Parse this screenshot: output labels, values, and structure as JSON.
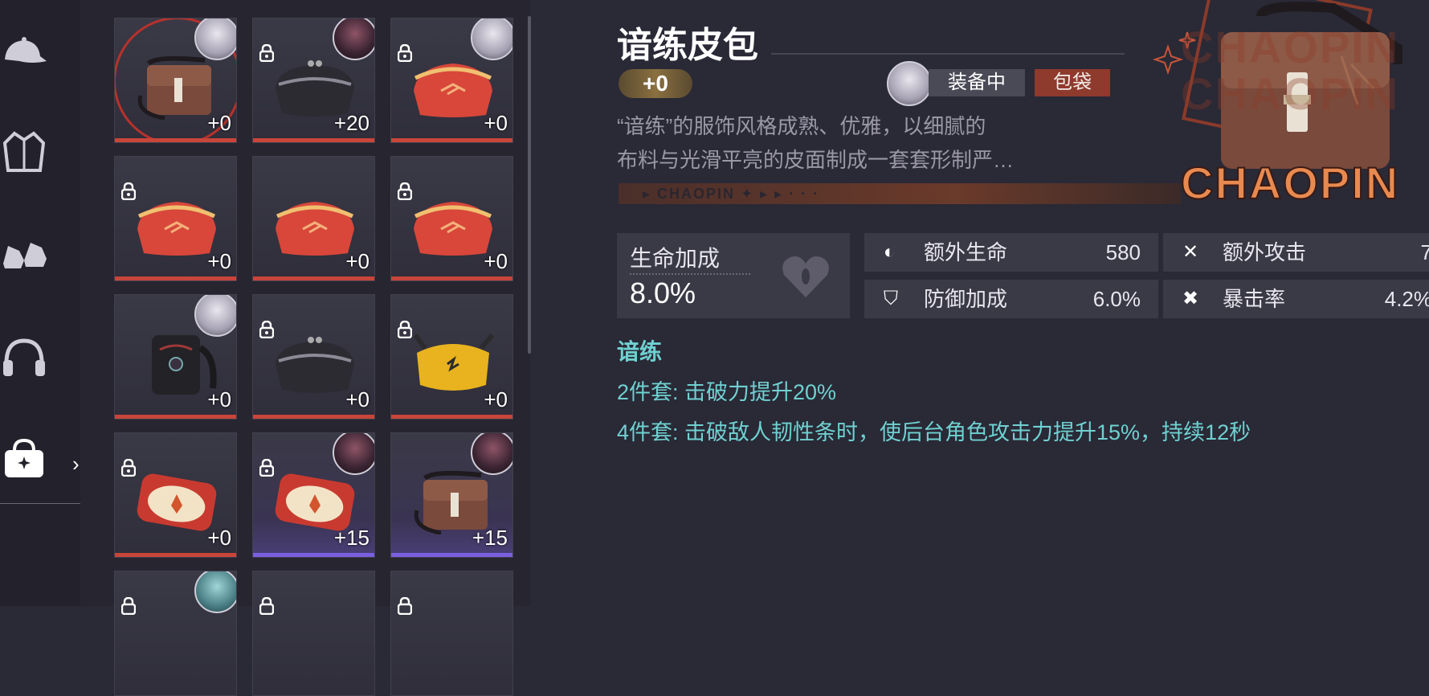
{
  "item": {
    "name": "谙练皮包",
    "level": "+0",
    "equipped_label": "装备中",
    "slot_label": "包袋",
    "description_line1": "“谙练”的服饰风格成熟、优雅，以细腻的",
    "description_line2": "布料与光滑平亮的皮面制成一套套形制严…",
    "brand_strip": "▸ CHAOPIN ✦ ▸ ▸ · · ·",
    "brand_big": "CHAOPIN",
    "brand_ghost": "CHAOPIN"
  },
  "main_stat": {
    "label": "生命加成",
    "value": "8.0%",
    "icon": "heart-shield-icon"
  },
  "sub_stats": [
    {
      "name": "额外生命",
      "value": "580",
      "icon": "heart-drop-icon"
    },
    {
      "name": "额外攻击",
      "value": "7",
      "icon": "crossed-swords-icon"
    },
    {
      "name": "防御加成",
      "value": "6.0%",
      "icon": "shield-icon"
    },
    {
      "name": "暴击率",
      "value": "4.2%",
      "icon": "crit-icon"
    }
  ],
  "set_bonus": {
    "name": "谙练",
    "two_piece": "2件套: 击破力提升20%",
    "four_piece": "4件套: 击破敌人韧性条时，使后台角色攻击力提升15%，持续12秒"
  },
  "sidebar": {
    "icons": [
      "cap-icon",
      "jacket-icon",
      "shoes-icon",
      "headphones-icon",
      "bag-icon"
    ],
    "active": "bag-icon"
  },
  "inventory": [
    {
      "level": "+0",
      "bag": "brown-satchel",
      "avatar": "white",
      "locked": false,
      "selected": true
    },
    {
      "level": "+20",
      "bag": "black-clutch",
      "avatar": "dark",
      "locked": true
    },
    {
      "level": "+0",
      "bag": "red-clutch",
      "avatar": "white",
      "locked": true
    },
    {
      "level": "+0",
      "bag": "red-clutch",
      "avatar": "",
      "locked": true
    },
    {
      "level": "+0",
      "bag": "red-clutch",
      "avatar": "",
      "locked": false
    },
    {
      "level": "+0",
      "bag": "red-clutch",
      "avatar": "",
      "locked": true
    },
    {
      "level": "+0",
      "bag": "black-backpack",
      "avatar": "white",
      "locked": false
    },
    {
      "level": "+0",
      "bag": "black-clutch",
      "avatar": "",
      "locked": true
    },
    {
      "level": "+0",
      "bag": "yellow-waistbag",
      "avatar": "",
      "locked": true
    },
    {
      "level": "+0",
      "bag": "red-pouch",
      "avatar": "",
      "locked": true
    },
    {
      "level": "+15",
      "bag": "red-pouch",
      "avatar": "dark",
      "locked": true,
      "rarity": "purple"
    },
    {
      "level": "+15",
      "bag": "brown-satchel",
      "avatar": "dark",
      "locked": false,
      "rarity": "purple"
    }
  ],
  "colors": {
    "accent_teal": "#6fd1d1",
    "tag_red": "#8e3a2d",
    "bar_red": "#c8453a",
    "bar_purple": "#7a5fe0"
  }
}
